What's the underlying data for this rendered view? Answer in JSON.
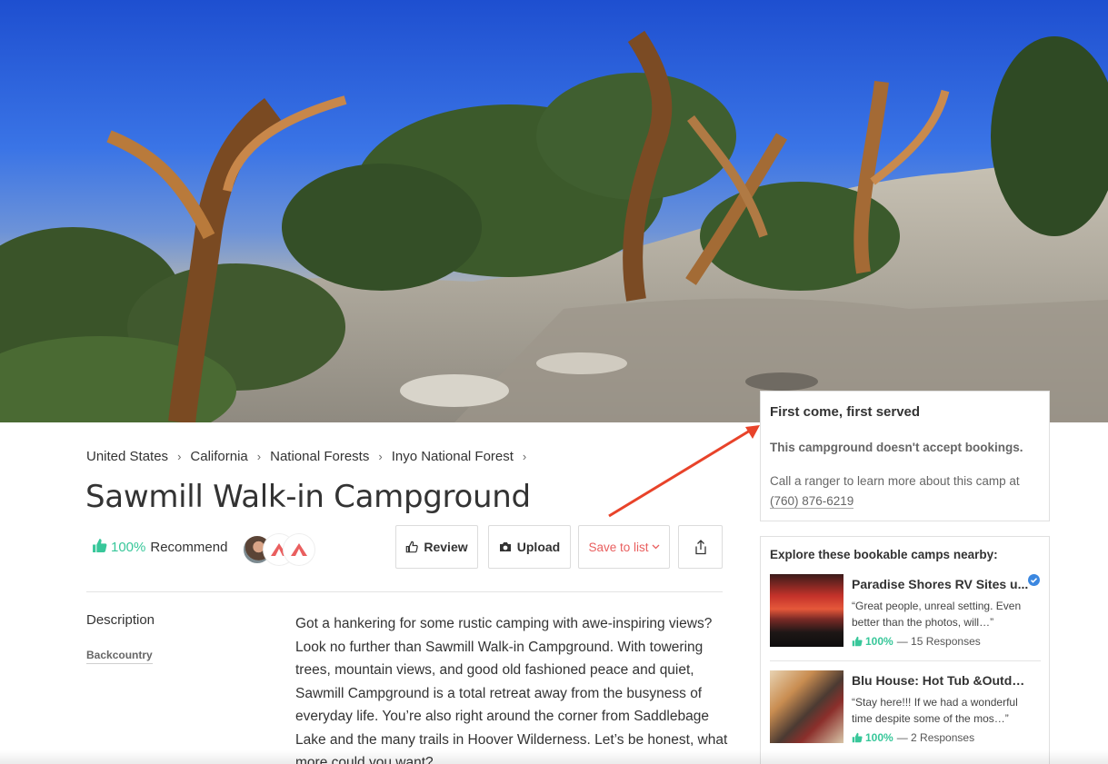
{
  "breadcrumb": [
    "United States",
    "California",
    "National Forests",
    "Inyo National Forest"
  ],
  "page": {
    "title": "Sawmill Walk-in Campground"
  },
  "recommend": {
    "percent": "100%",
    "label": "Recommend"
  },
  "actions": {
    "review": "Review",
    "upload": "Upload",
    "save": "Save to list",
    "share_icon": "share-icon"
  },
  "description": {
    "label": "Description",
    "tag": "Backcountry",
    "text": "Got a hankering for some rustic camping with awe-inspiring views? Look no further than Sawmill Walk-in Campground. With towering trees, mountain views, and good old fashioned peace and quiet, Sawmill Campground is a total retreat away from the busyness of everyday life. You’re also right around the corner from Saddlebage Lake and the many trails in Hoover Wilderness. Let’s be honest, what more could you want?"
  },
  "booking": {
    "heading": "First come, first served",
    "subheading": "This campground doesn't accept bookings.",
    "body": "Call a ranger to learn more about this camp at ",
    "phone": "(760) 876-6219"
  },
  "nearby": {
    "heading": "Explore these bookable camps nearby:",
    "camps": [
      {
        "name": "Paradise Shores RV Sites u...",
        "quote": "“Great people, unreal setting. Even better than the photos, will…”",
        "percent": "100%",
        "responses": "— 15 Responses",
        "verified": true
      },
      {
        "name": "Blu House: Hot Tub &Outdo...",
        "quote": "“Stay here!!! If we had a wonderful time despite some of the mos…”",
        "percent": "100%",
        "responses": "— 2 Responses",
        "verified": false
      }
    ]
  },
  "colors": {
    "accent_green": "#38c79a",
    "save_red": "#e95f5f",
    "annotation_arrow": "#e8432a"
  }
}
